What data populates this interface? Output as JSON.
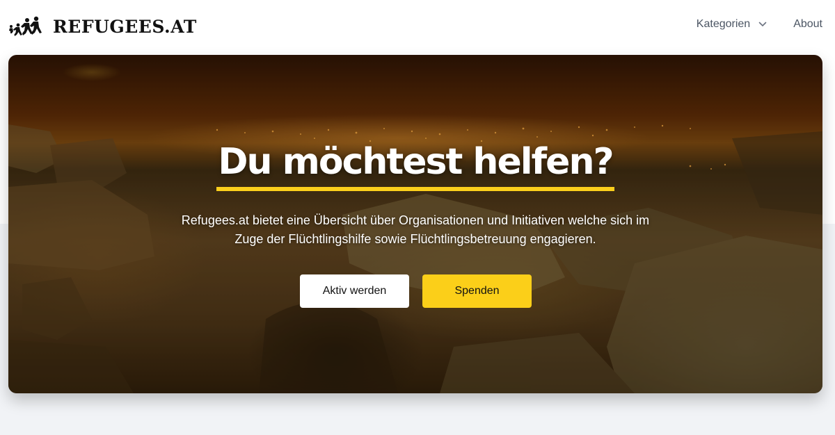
{
  "header": {
    "logo_text": "REFUGEES.AT",
    "logo_icon": "running-family-icon",
    "nav": [
      {
        "label": "Kategorien",
        "has_dropdown": true
      },
      {
        "label": "About"
      }
    ]
  },
  "hero": {
    "title": "Du möchtest helfen?",
    "description_line1": "Refugees.at bietet eine Übersicht über Organisationen und Initiativen welche sich im",
    "description_line2": "Zuge der Flüchtlingshilfe sowie Flüchtlingsbetreuung engagieren.",
    "buttons": {
      "primary_label": "Aktiv werden",
      "secondary_label": "Spenden"
    }
  },
  "colors": {
    "accent_yellow": "#fbcf19",
    "text_dark": "#111111",
    "nav_text": "#4b5563",
    "page_background_lower": "#f1f3f6"
  }
}
